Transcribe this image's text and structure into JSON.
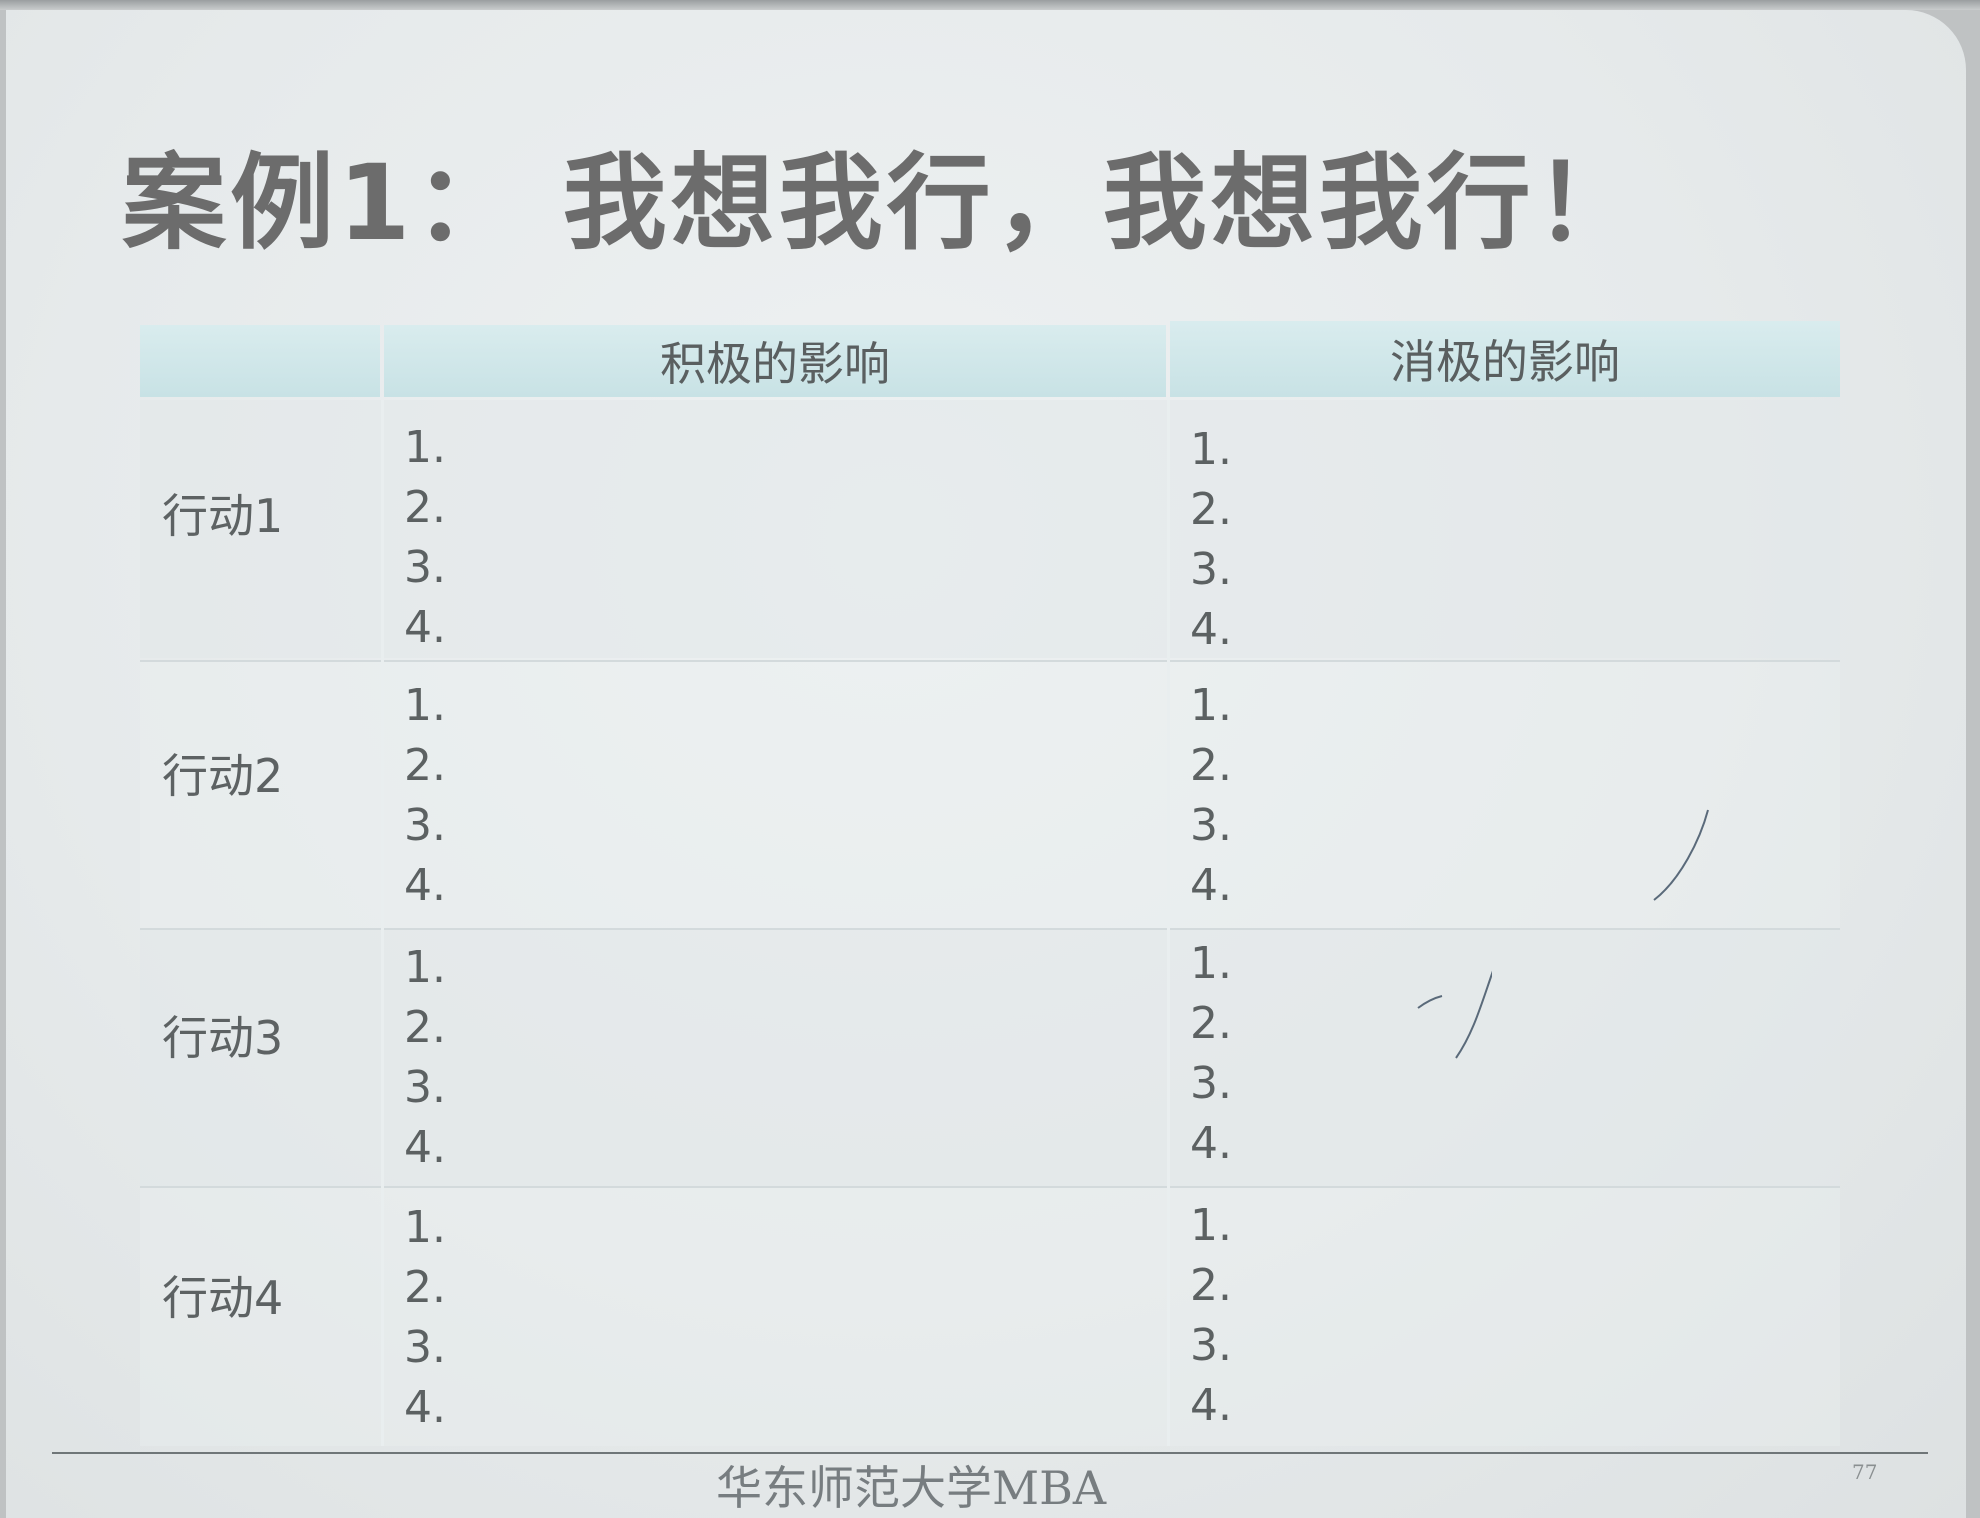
{
  "slide": {
    "title": "案例1：  我想我行，我想我行！",
    "table": {
      "columns": [
        "",
        "积极的影响",
        "消极的影响"
      ],
      "rows": [
        {
          "label": "行动1",
          "positive": [
            "1.",
            "2.",
            "3.",
            "4."
          ],
          "negative": [
            "1.",
            "2.",
            "3.",
            "4."
          ]
        },
        {
          "label": "行动2",
          "positive": [
            "1.",
            "2.",
            "3.",
            "4."
          ],
          "negative": [
            "1.",
            "2.",
            "3.",
            "4."
          ]
        },
        {
          "label": "行动3",
          "positive": [
            "1.",
            "2.",
            "3.",
            "4."
          ],
          "negative": [
            "1.",
            "2.",
            "3.",
            "4."
          ]
        },
        {
          "label": "行动4",
          "positive": [
            "1.",
            "2.",
            "3.",
            "4."
          ],
          "negative": [
            "1.",
            "2.",
            "3.",
            "4."
          ]
        }
      ]
    },
    "footer": "华东师范大学MBA",
    "page_number": "77"
  },
  "colors": {
    "header_fill": "#cfe6e9",
    "title_text": "#6c6c6c",
    "body_text": "#5c6162"
  }
}
